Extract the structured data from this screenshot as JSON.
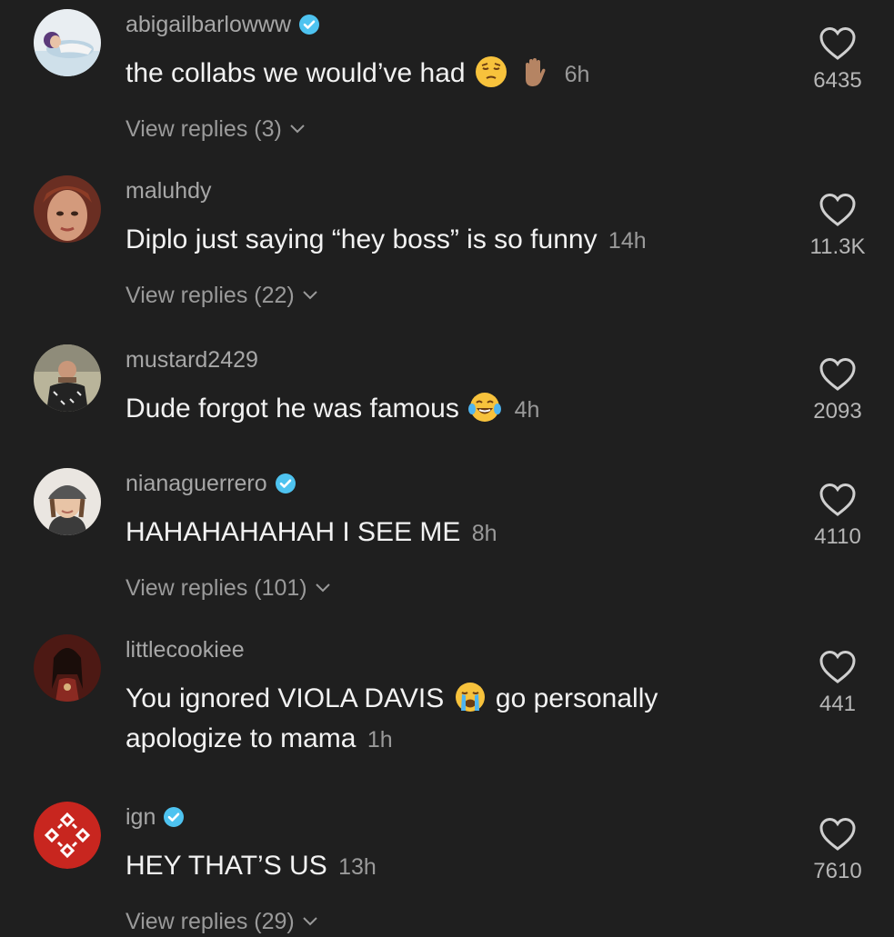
{
  "comments": [
    {
      "username": "abigailbarlowww",
      "verified": true,
      "text": "the collabs we would’ve had",
      "emojis": [
        "pensive-face",
        "raised-hand"
      ],
      "time": "6h",
      "replies": "View replies (3)",
      "likes": "6435"
    },
    {
      "username": "maluhdy",
      "verified": false,
      "text": "Diplo just saying “hey boss” is so funny",
      "time": "14h",
      "replies": "View replies (22)",
      "likes": "11.3K"
    },
    {
      "username": "mustard2429",
      "verified": false,
      "text": "Dude forgot he was famous",
      "emojis": [
        "face-with-tears-of-joy"
      ],
      "time": "4h",
      "likes": "2093"
    },
    {
      "username": "nianaguerrero",
      "verified": true,
      "text": "HAHAHAHAHAH I SEE ME",
      "time": "8h",
      "replies": "View replies (101)",
      "likes": "4110"
    },
    {
      "username": "littlecookiee",
      "verified": false,
      "text_a": "You ignored VIOLA DAVIS",
      "emojis": [
        "loudly-crying-face"
      ],
      "text_b": "go personally apologize to mama",
      "time": "1h",
      "likes": "441"
    },
    {
      "username": "ign",
      "verified": true,
      "text": "HEY THAT’S US",
      "time": "13h",
      "replies": "View replies (29)",
      "likes": "7610"
    }
  ],
  "colors": {
    "background": "#1f1f1f",
    "verified": "#4ec3f0",
    "ign_red": "#c8261f"
  }
}
